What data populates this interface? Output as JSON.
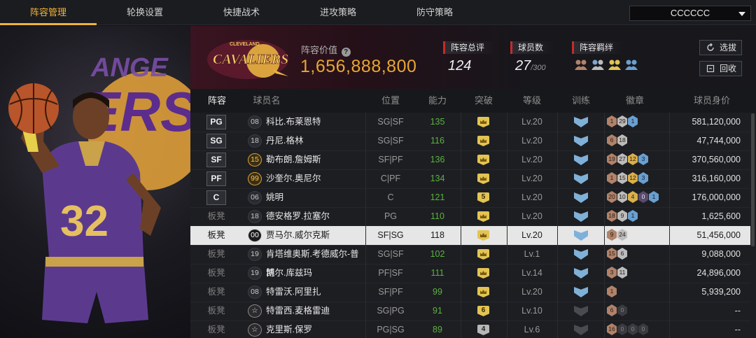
{
  "nav": {
    "tabs": [
      "阵容管理",
      "轮换设置",
      "快捷战术",
      "进攻策略",
      "防守策略"
    ],
    "active_tab": 0,
    "team_select": "CCCCCC"
  },
  "header": {
    "logo_text": "CAVALIERS",
    "logo_sub": "CLEVELAND",
    "value_label": "阵容价值",
    "value": "1,656,888,800",
    "overall_label": "阵容总评",
    "overall": "124",
    "players_label": "球员数",
    "players_count": "27",
    "players_max": "/300",
    "bond_label": "阵容羁绊",
    "select_btn": "选拔",
    "recall_btn": "回收"
  },
  "hero": {
    "jersey": "32",
    "bg_text_1": "ANGE",
    "bg_text_2": "ERS"
  },
  "table": {
    "headers": [
      "阵容",
      "球员名",
      "位置",
      "能力",
      "突破",
      "等级",
      "训练",
      "徽章",
      "球员身价"
    ],
    "rows": [
      {
        "slot": "PG",
        "starter": true,
        "num": "08",
        "num_style": "",
        "name": "科比.布莱恩特",
        "pos": "SG|SF",
        "rating": "135",
        "brk": "",
        "level": "Lv.20",
        "train": true,
        "badges": [
          [
            "b",
            "1"
          ],
          [
            "s",
            "29"
          ],
          [
            "h",
            "1"
          ]
        ],
        "salary": "581,120,000"
      },
      {
        "slot": "SG",
        "starter": true,
        "num": "18",
        "num_style": "",
        "name": "丹尼.格林",
        "pos": "SG|SF",
        "rating": "116",
        "brk": "",
        "level": "Lv.20",
        "train": true,
        "badges": [
          [
            "b",
            "6"
          ],
          [
            "s",
            "18"
          ]
        ],
        "salary": "47,744,000"
      },
      {
        "slot": "SF",
        "starter": true,
        "num": "15",
        "num_style": "gold",
        "name": "勒布朗.詹姆斯",
        "pos": "SF|PF",
        "rating": "136",
        "brk": "",
        "level": "Lv.20",
        "train": true,
        "badges": [
          [
            "b",
            "19"
          ],
          [
            "s",
            "27"
          ],
          [
            "g",
            "12"
          ],
          [
            "h",
            "3"
          ]
        ],
        "salary": "370,560,000"
      },
      {
        "slot": "PF",
        "starter": true,
        "num": "99",
        "num_style": "gold",
        "name": "沙奎尔.奥尼尔",
        "pos": "C|PF",
        "rating": "134",
        "brk": "",
        "level": "Lv.20",
        "train": true,
        "badges": [
          [
            "b",
            "1"
          ],
          [
            "s",
            "15"
          ],
          [
            "g",
            "12"
          ],
          [
            "h",
            "3"
          ]
        ],
        "salary": "316,160,000"
      },
      {
        "slot": "C",
        "starter": true,
        "num": "06",
        "num_style": "",
        "name": "姚明",
        "pos": "C",
        "rating": "121",
        "brk": "5",
        "level": "Lv.20",
        "train": true,
        "badges": [
          [
            "b",
            "20"
          ],
          [
            "s",
            "10"
          ],
          [
            "g",
            "4"
          ],
          [
            "p",
            "0"
          ],
          [
            "h",
            "1"
          ]
        ],
        "salary": "176,000,000"
      },
      {
        "slot": "板凳",
        "starter": false,
        "num": "18",
        "num_style": "",
        "name": "德安格罗.拉塞尔",
        "pos": "PG",
        "rating": "110",
        "brk": "",
        "level": "Lv.20",
        "train": true,
        "badges": [
          [
            "b",
            "18"
          ],
          [
            "s",
            "9"
          ],
          [
            "h",
            "1"
          ]
        ],
        "salary": "1,625,600"
      },
      {
        "slot": "板凳",
        "starter": false,
        "num": "00",
        "num_style": "dark",
        "name": "贾马尔.威尔克斯",
        "pos": "SF|SG",
        "rating": "118",
        "brk": "",
        "level": "Lv.20",
        "train": true,
        "badges": [
          [
            "b",
            "9"
          ],
          [
            "s",
            "24"
          ]
        ],
        "salary": "51,456,000",
        "selected": true
      },
      {
        "slot": "板凳",
        "starter": false,
        "num": "19",
        "num_style": "",
        "name": "肯塔维奥斯.考德威尔-普博",
        "pos": "SG|SF",
        "rating": "102",
        "brk": "",
        "level": "Lv.1",
        "train": true,
        "badges": [
          [
            "b",
            "15"
          ],
          [
            "s",
            "6"
          ]
        ],
        "salary": "9,088,000"
      },
      {
        "slot": "板凳",
        "starter": false,
        "num": "19",
        "num_style": "",
        "name": "凯尔.库兹玛",
        "pos": "PF|SF",
        "rating": "111",
        "brk": "",
        "level": "Lv.14",
        "train": true,
        "badges": [
          [
            "b",
            "3"
          ],
          [
            "s",
            "11"
          ]
        ],
        "salary": "24,896,000"
      },
      {
        "slot": "板凳",
        "starter": false,
        "num": "08",
        "num_style": "",
        "name": "特雷沃.阿里扎",
        "pos": "SF|PF",
        "rating": "99",
        "brk": "",
        "level": "Lv.20",
        "train": true,
        "badges": [
          [
            "b",
            "1"
          ]
        ],
        "salary": "5,939,200"
      },
      {
        "slot": "板凳",
        "starter": false,
        "num": "☆",
        "num_style": "star",
        "name": "特雷西.麦格雷迪",
        "pos": "SG|PG",
        "rating": "91",
        "brk": "6",
        "level": "Lv.10",
        "train": false,
        "badges": [
          [
            "b",
            "6"
          ],
          [
            "d",
            "0"
          ]
        ],
        "salary": "--"
      },
      {
        "slot": "板凳",
        "starter": false,
        "num": "☆",
        "num_style": "star",
        "name": "克里斯.保罗",
        "pos": "PG|SG",
        "rating": "89",
        "brk": "4",
        "brk_grey": true,
        "level": "Lv.6",
        "train": false,
        "badges": [
          [
            "b",
            "16"
          ],
          [
            "d",
            "0"
          ],
          [
            "d",
            "0"
          ],
          [
            "d",
            "0"
          ]
        ],
        "salary": "--"
      }
    ]
  },
  "colors": {
    "accent": "#f0b33a",
    "value": "#e8a732",
    "rating_green": "#59b33f",
    "stat_marker": "#c52a2a"
  }
}
